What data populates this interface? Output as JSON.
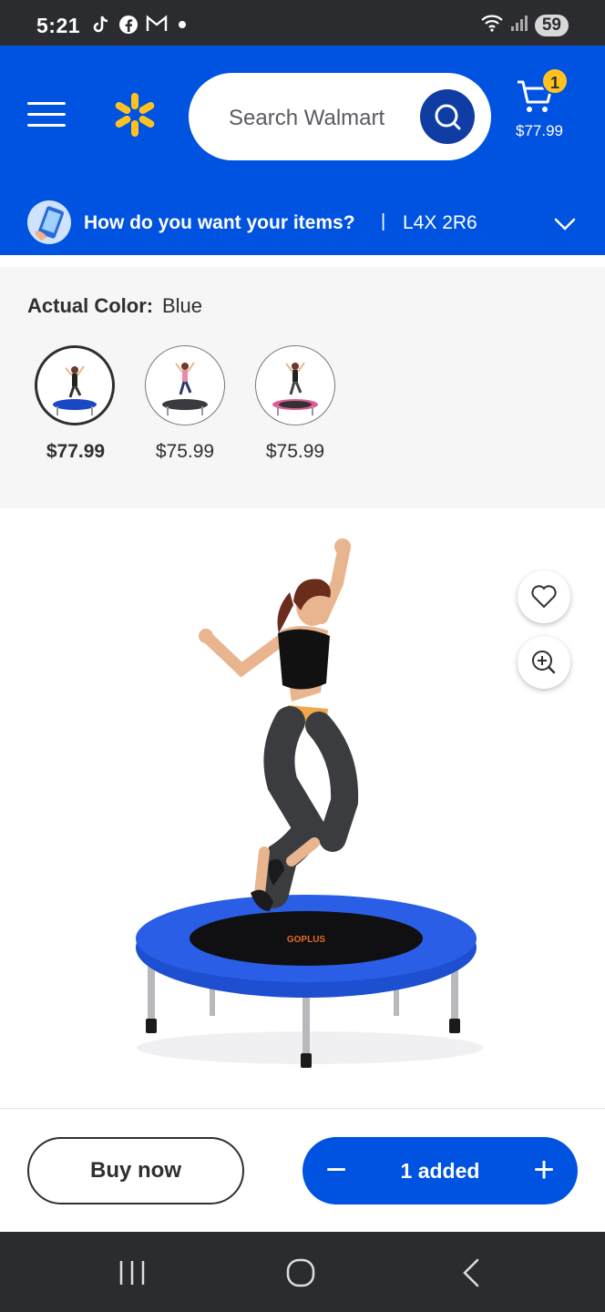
{
  "status_bar": {
    "time": "5:21",
    "battery": "59",
    "left_icons": [
      "tiktok-icon",
      "facebook-icon",
      "gmail-icon"
    ],
    "right_icons": [
      "wifi-icon",
      "signal-icon"
    ]
  },
  "header": {
    "search_placeholder": "Search Walmart",
    "cart_count": "1",
    "cart_total": "$77.99",
    "colors": {
      "brand_blue": "#0052e0",
      "spark_yellow": "#ffc220"
    }
  },
  "delivery": {
    "title": "How do you want your items?",
    "separator": "|",
    "postal_code": "L4X 2R6"
  },
  "color_selector": {
    "label": "Actual Color:",
    "value": "Blue",
    "swatches": [
      {
        "name": "Blue",
        "price": "$77.99",
        "selected": true,
        "color": "#1a47c4"
      },
      {
        "name": "Gray",
        "price": "$75.99",
        "selected": false,
        "color": "#808285"
      },
      {
        "name": "Pink",
        "price": "$75.99",
        "selected": false,
        "color": "#e05a9a"
      }
    ]
  },
  "product": {
    "brand_on_mat": "GOPLUS"
  },
  "actions": {
    "buy_now": "Buy now",
    "added_label": "1 added",
    "minus": "−",
    "plus": "+"
  }
}
